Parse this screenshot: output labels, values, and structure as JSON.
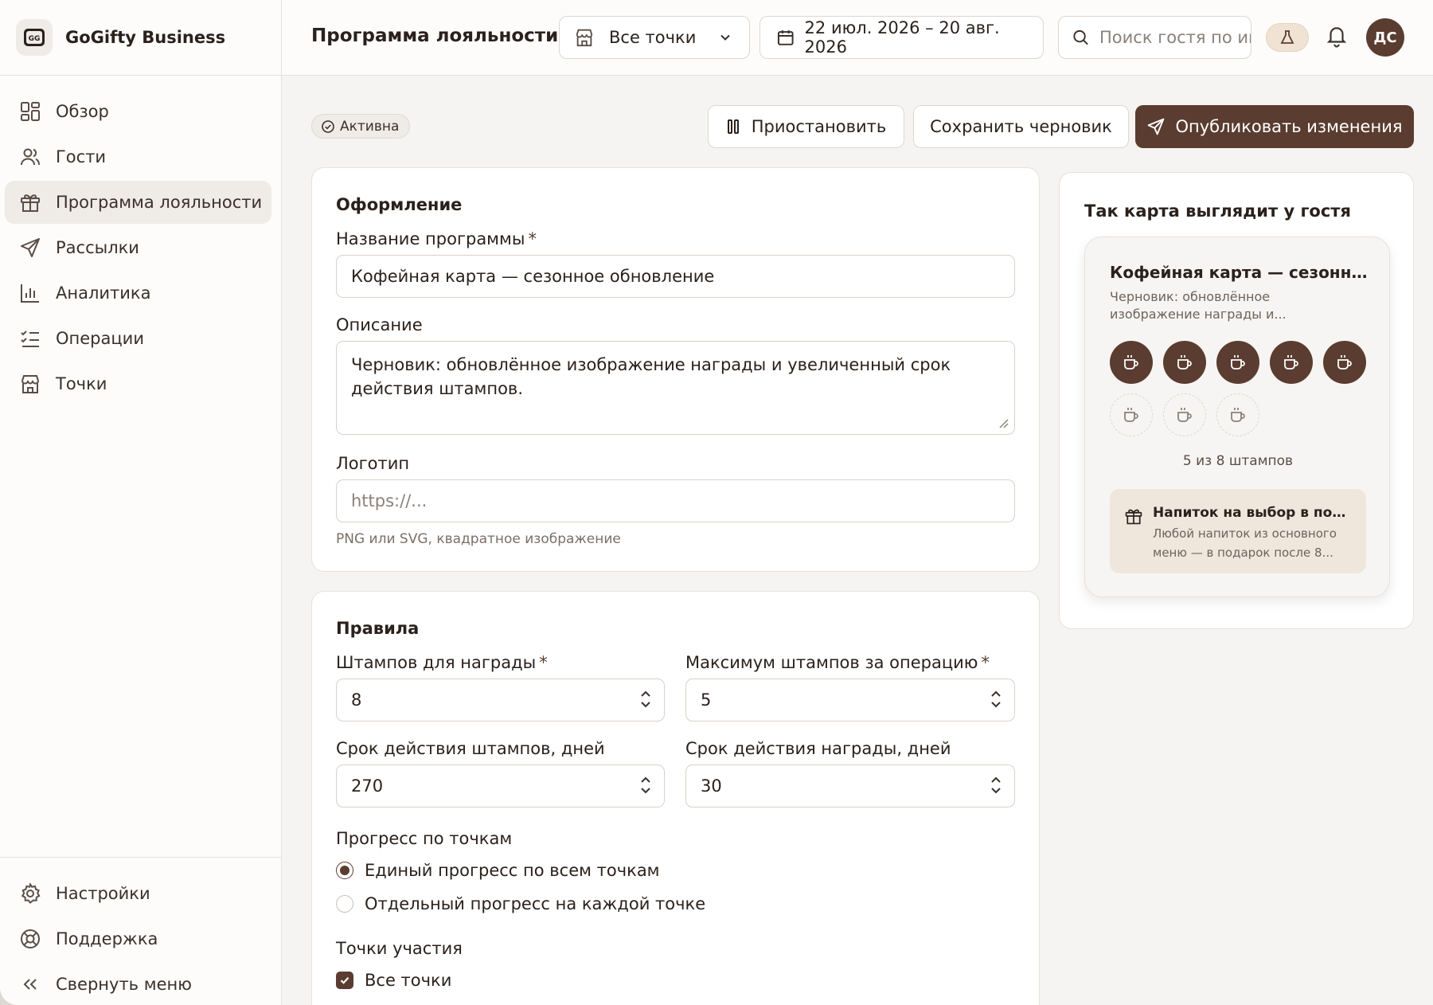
{
  "brand": {
    "name": "GoGifty Business",
    "logo_text": "GG"
  },
  "sidebar": {
    "items": [
      {
        "label": "Обзор",
        "icon": "dashboard-icon"
      },
      {
        "label": "Гости",
        "icon": "users-icon"
      },
      {
        "label": "Программа лояльности",
        "icon": "gift-icon",
        "active": true
      },
      {
        "label": "Рассылки",
        "icon": "send-icon"
      },
      {
        "label": "Аналитика",
        "icon": "chart-icon"
      },
      {
        "label": "Операции",
        "icon": "list-check-icon"
      },
      {
        "label": "Точки",
        "icon": "store-icon"
      }
    ],
    "bottom": [
      {
        "label": "Настройки",
        "icon": "gear-icon"
      },
      {
        "label": "Поддержка",
        "icon": "lifebuoy-icon"
      },
      {
        "label": "Свернуть меню",
        "icon": "chevrons-left-icon"
      }
    ]
  },
  "header": {
    "title": "Программа лояльности",
    "store_select": "Все точки",
    "date_range": "22 июл. 2026 – 20 авг. 2026",
    "search_placeholder": "Поиск гостя по имени",
    "avatar_initials": "ДС"
  },
  "toolbar": {
    "status": "Активна",
    "pause_label": "Приостановить",
    "draft_label": "Сохранить черновик",
    "publish_label": "Опубликовать изменения"
  },
  "design": {
    "title": "Оформление",
    "name_label": "Название программы",
    "name_value": "Кофейная карта — сезонное обновление",
    "description_label": "Описание",
    "description_value": "Черновик: обновлённое изображение награды и увеличенный срок действия штампов.",
    "logo_label": "Логотип",
    "logo_placeholder": "https://...",
    "logo_hint": "PNG или SVG, квадратное изображение"
  },
  "rules": {
    "title": "Правила",
    "stamps_for_reward_label": "Штампов для награды",
    "stamps_for_reward_value": "8",
    "max_stamps_label": "Максимум штампов за операцию",
    "max_stamps_value": "5",
    "stamp_validity_label": "Срок действия штампов, дней",
    "stamp_validity_value": "270",
    "reward_validity_label": "Срок действия награды, дней",
    "reward_validity_value": "30",
    "progress_label": "Прогресс по точкам",
    "progress_options": [
      {
        "label": "Единый прогресс по всем точкам",
        "selected": true
      },
      {
        "label": "Отдельный прогресс на каждой точке",
        "selected": false
      }
    ],
    "points_label": "Точки участия",
    "all_points_label": "Все точки",
    "all_points_checked": true
  },
  "preview": {
    "title": "Так карта выглядит у гостя",
    "card_name": "Кофейная карта — сезонное обновление",
    "card_desc": "Черновик: обновлённое изображение награды и...",
    "stamps_total": 8,
    "stamps_filled": 5,
    "progress_text": "5 из 8 штампов",
    "reward_title": "Напиток на выбор в подарок",
    "reward_desc": "Любой напиток из основного меню — в подарок после 8..."
  },
  "colors": {
    "accent": "#5a3d30",
    "reward_bg": "#efe6dc",
    "background": "#f6f4f2"
  }
}
